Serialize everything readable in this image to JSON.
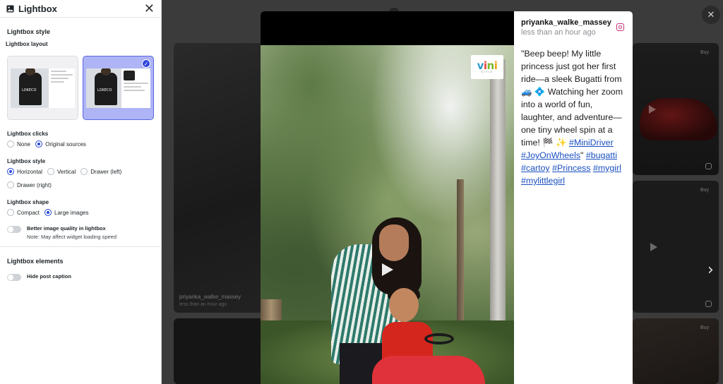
{
  "panel": {
    "title": "Lightbox",
    "style_section": "Lightbox style",
    "layout_label": "Lightbox layout",
    "layout_card_brand": "LOKECO",
    "clicks": {
      "label": "Lightbox clicks",
      "options": [
        "None",
        "Original sources"
      ],
      "selected": "Original sources"
    },
    "style": {
      "label": "Lightbox style",
      "options": [
        "Horizontal",
        "Vertical",
        "Drawer (left)",
        "Drawer (right)"
      ],
      "selected": "Horizontal"
    },
    "shape": {
      "label": "Lightbox shape",
      "options": [
        "Compact",
        "Large images"
      ],
      "selected": "Large images"
    },
    "quality_toggle": {
      "label": "Better image quality in lightbox",
      "note": "Note: May affect widget loading speed",
      "on": false
    },
    "elements_section": "Lightbox elements",
    "hide_caption_toggle": {
      "label": "Hide post caption",
      "on": false
    }
  },
  "background": {
    "left_tile_user": "priyanka_walke_massey",
    "left_tile_time": "less than an hour ago",
    "buy_label": "Buy"
  },
  "lightbox": {
    "username": "priyanka_walke_massey",
    "time": "less than an hour ago",
    "logo_text": "vini",
    "logo_sub": "STYLE",
    "caption_text": "\"Beep beep! My little princess just got her first ride—a sleek Bugatti from 🚙 💠 Watching her zoom into a world of fun, laughter, and adventure—one tiny wheel spin at a time! 🏁 ✨ ",
    "hashtags": [
      "#MiniDriver",
      "#JoyOnWheels",
      "#bugatti",
      "#cartoy",
      "#Princess",
      "#mygirl",
      "#mylittlegirl"
    ],
    "close_icon": "close-icon",
    "next_icon": "chevron-right-icon"
  },
  "colors": {
    "accent": "#2547d8",
    "selected_card": "#aeb4f5",
    "hashtag": "#1a4fc0",
    "overlay": "#3b3b3b"
  }
}
